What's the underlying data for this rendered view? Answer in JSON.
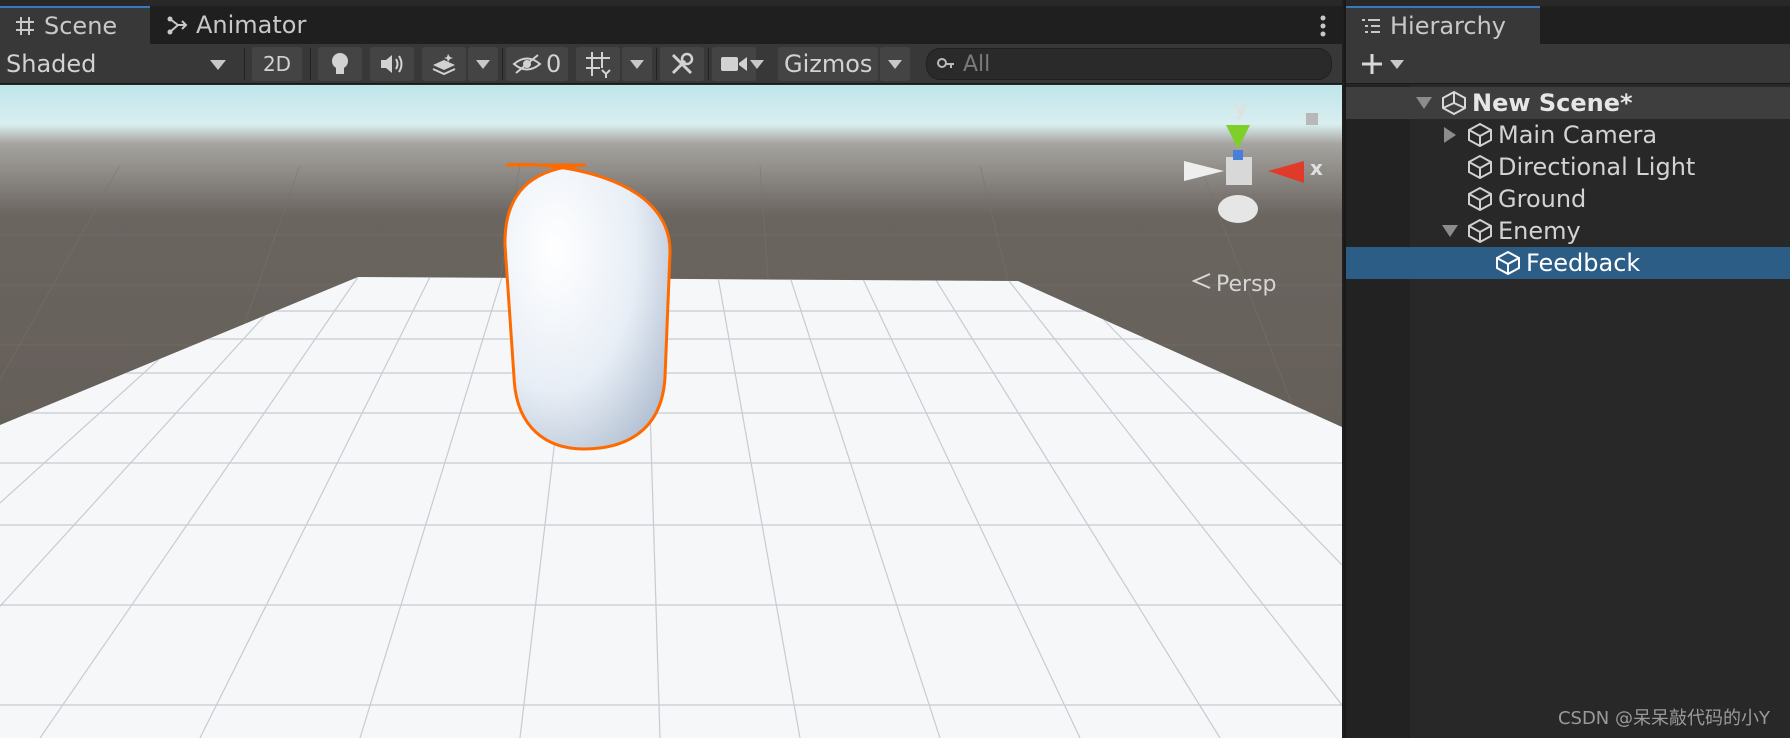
{
  "scene_tabs": {
    "scene": "Scene",
    "animator": "Animator"
  },
  "scene_toolbar": {
    "draw_mode": "Shaded",
    "two_d": "2D",
    "hidden_count": "0",
    "gizmos": "Gizmos",
    "search_placeholder": "All"
  },
  "viewport": {
    "gizmo_y": "y",
    "gizmo_x": "x",
    "projection": "Persp"
  },
  "hierarchy": {
    "tab": "Hierarchy",
    "scene_name": "New Scene*",
    "items": [
      {
        "label": "Main Camera"
      },
      {
        "label": "Directional Light"
      },
      {
        "label": "Ground"
      },
      {
        "label": "Enemy"
      },
      {
        "label": "Feedback"
      }
    ]
  },
  "watermark": "CSDN @呆呆敲代码的小Y",
  "colors": {
    "accent": "#3a79bb",
    "selection": "#2c5d87",
    "outline": "#ff6a00",
    "axis_x": "#e23a2a",
    "axis_y": "#7fcf2a"
  }
}
